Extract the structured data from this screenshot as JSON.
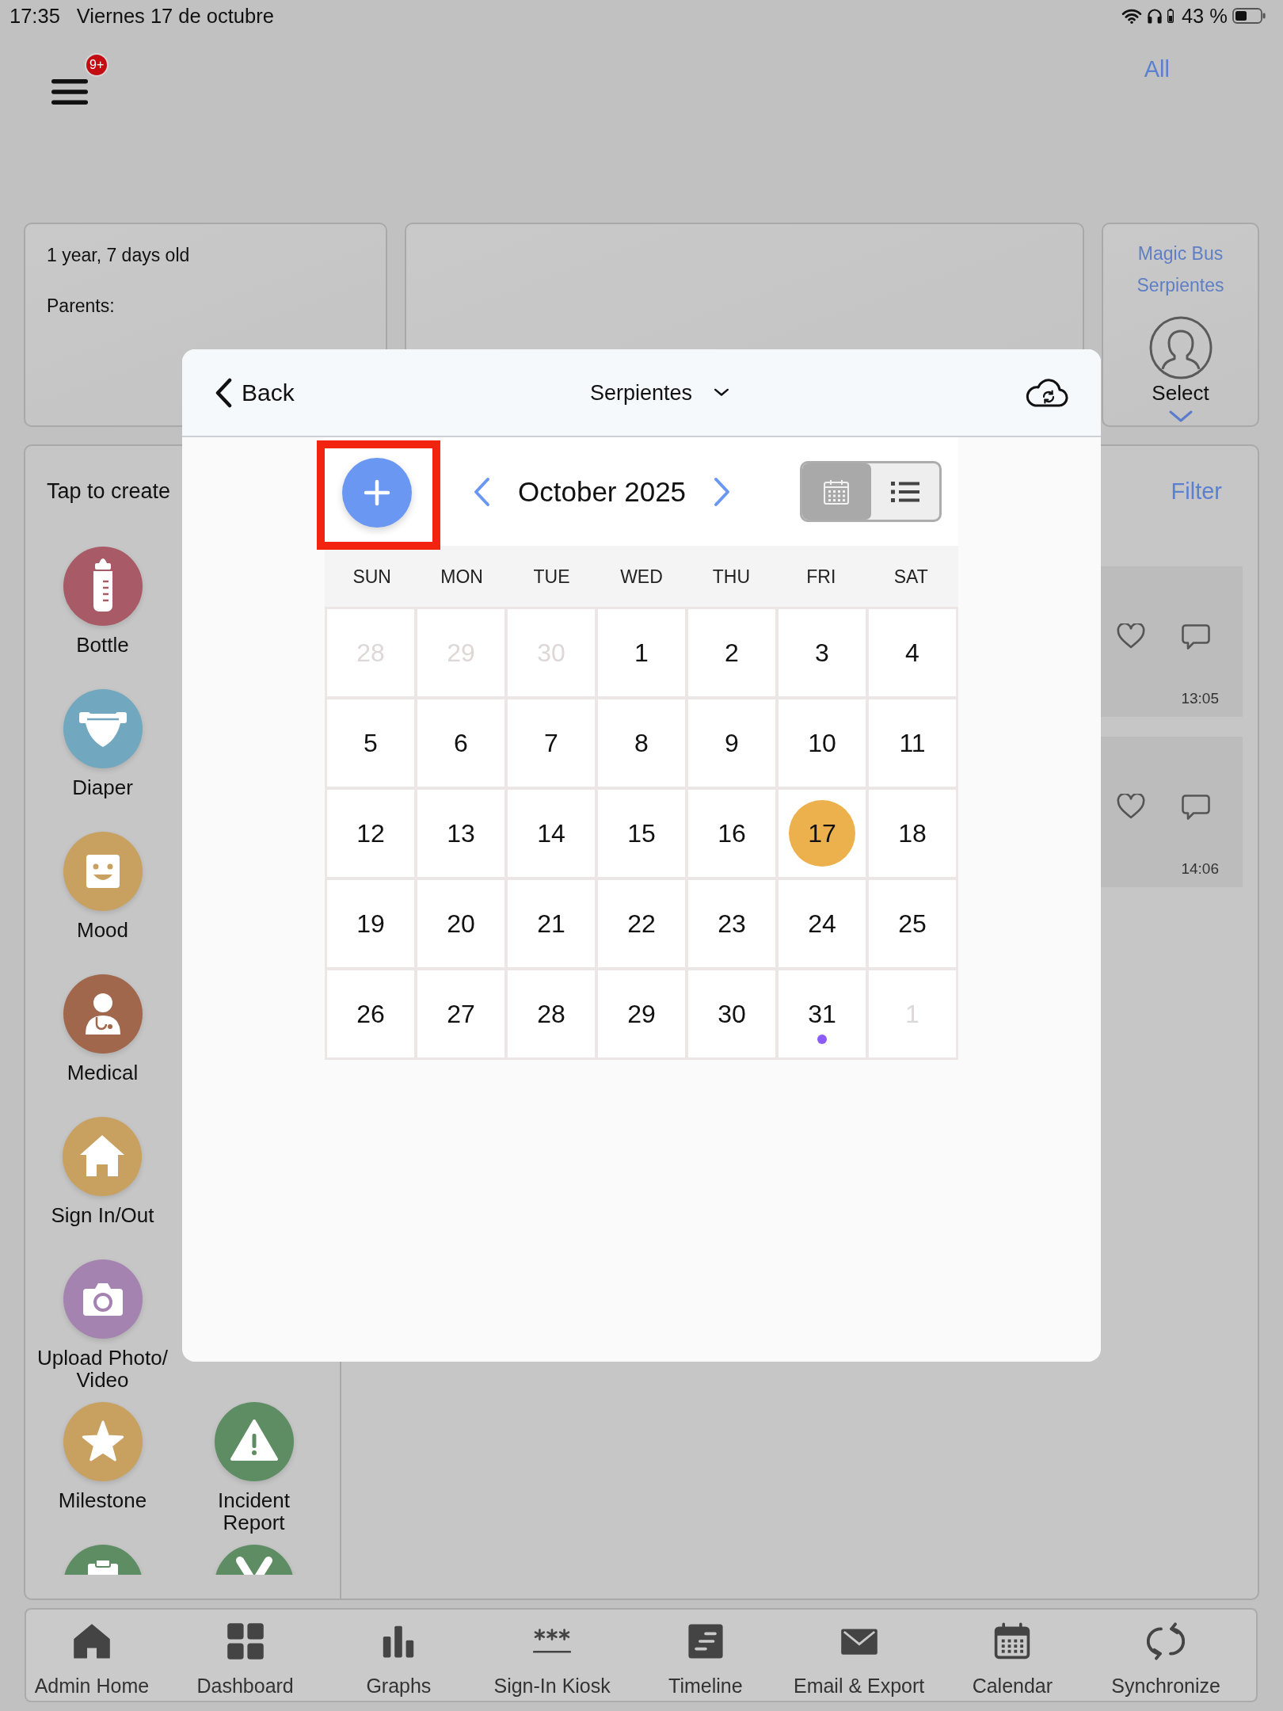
{
  "status_bar": {
    "time": "17:35",
    "date": "Viernes 17 de octubre",
    "battery": "43 %"
  },
  "header": {
    "badge": "9+",
    "all_link": "All"
  },
  "child_card": {
    "age": "1 year, 7 days old",
    "parents": "Parents:"
  },
  "group_card": {
    "bus": "Magic Bus",
    "room": "Serpientes",
    "select": "Select"
  },
  "create_panel": {
    "title": "Tap to create",
    "actions": [
      {
        "kind": "bottle",
        "label": "Bottle",
        "color": "#a85b66"
      },
      {
        "kind": "diaper",
        "label": "Diaper",
        "color": "#72a8bf"
      },
      {
        "kind": "mood",
        "label": "Mood",
        "color": "#c8a160"
      },
      {
        "kind": "medical",
        "label": "Medical",
        "color": "#a0674c"
      },
      {
        "kind": "sign_in_out",
        "label": "Sign In/Out",
        "color": "#c8a160"
      },
      {
        "kind": "photo",
        "label": "Upload Photo/​Video",
        "color": "#a583b0"
      },
      {
        "kind": "milestone",
        "label": "Milestone",
        "color": "#c8a160"
      },
      {
        "kind": "incident",
        "label": "Incident Report",
        "color": "#5e8d64"
      },
      {
        "kind": "clipboard",
        "color": "#5e8d64"
      },
      {
        "kind": "cross",
        "color": "#5e8d64"
      }
    ]
  },
  "timeline": {
    "filter": "Filter",
    "entries": [
      {
        "time": "13:05"
      },
      {
        "time": "14:06"
      }
    ]
  },
  "modal": {
    "back": "Back",
    "group": "Serpientes",
    "add_button_highlighted": true,
    "month": "October 2025",
    "view_modes": [
      {
        "kind": "calendar",
        "selected": true
      },
      {
        "kind": "list",
        "selected": false
      }
    ],
    "weekdays": [
      "SUN",
      "MON",
      "TUE",
      "WED",
      "THU",
      "FRI",
      "SAT"
    ],
    "days": [
      {
        "day": "28",
        "in_month": false,
        "today": false,
        "event": false
      },
      {
        "day": "29",
        "in_month": false,
        "today": false,
        "event": false
      },
      {
        "day": "30",
        "in_month": false,
        "today": false,
        "event": false
      },
      {
        "day": "1",
        "in_month": true,
        "today": false,
        "event": false
      },
      {
        "day": "2",
        "in_month": true,
        "today": false,
        "event": false
      },
      {
        "day": "3",
        "in_month": true,
        "today": false,
        "event": false
      },
      {
        "day": "4",
        "in_month": true,
        "today": false,
        "event": false
      },
      {
        "day": "5",
        "in_month": true,
        "today": false,
        "event": false
      },
      {
        "day": "6",
        "in_month": true,
        "today": false,
        "event": false
      },
      {
        "day": "7",
        "in_month": true,
        "today": false,
        "event": false
      },
      {
        "day": "8",
        "in_month": true,
        "today": false,
        "event": false
      },
      {
        "day": "9",
        "in_month": true,
        "today": false,
        "event": false
      },
      {
        "day": "10",
        "in_month": true,
        "today": false,
        "event": false
      },
      {
        "day": "11",
        "in_month": true,
        "today": false,
        "event": false
      },
      {
        "day": "12",
        "in_month": true,
        "today": false,
        "event": false
      },
      {
        "day": "13",
        "in_month": true,
        "today": false,
        "event": false
      },
      {
        "day": "14",
        "in_month": true,
        "today": false,
        "event": false
      },
      {
        "day": "15",
        "in_month": true,
        "today": false,
        "event": false
      },
      {
        "day": "16",
        "in_month": true,
        "today": false,
        "event": false
      },
      {
        "day": "17",
        "in_month": true,
        "today": true,
        "event": false
      },
      {
        "day": "18",
        "in_month": true,
        "today": false,
        "event": false
      },
      {
        "day": "19",
        "in_month": true,
        "today": false,
        "event": false
      },
      {
        "day": "20",
        "in_month": true,
        "today": false,
        "event": false
      },
      {
        "day": "21",
        "in_month": true,
        "today": false,
        "event": false
      },
      {
        "day": "22",
        "in_month": true,
        "today": false,
        "event": false
      },
      {
        "day": "23",
        "in_month": true,
        "today": false,
        "event": false
      },
      {
        "day": "24",
        "in_month": true,
        "today": false,
        "event": false
      },
      {
        "day": "25",
        "in_month": true,
        "today": false,
        "event": false
      },
      {
        "day": "26",
        "in_month": true,
        "today": false,
        "event": false
      },
      {
        "day": "27",
        "in_month": true,
        "today": false,
        "event": false
      },
      {
        "day": "28",
        "in_month": true,
        "today": false,
        "event": false
      },
      {
        "day": "29",
        "in_month": true,
        "today": false,
        "event": false
      },
      {
        "day": "30",
        "in_month": true,
        "today": false,
        "event": false
      },
      {
        "day": "31",
        "in_month": true,
        "today": false,
        "event": true
      },
      {
        "day": "1",
        "in_month": false,
        "today": false,
        "event": false
      }
    ]
  },
  "tab_bar": [
    {
      "kind": "home",
      "label": "Admin Home"
    },
    {
      "kind": "dashboard",
      "label": "Dashboard"
    },
    {
      "kind": "graphs",
      "label": "Graphs"
    },
    {
      "kind": "kiosk",
      "label": "Sign-In Kiosk"
    },
    {
      "kind": "timeline",
      "label": "Timeline"
    },
    {
      "kind": "email",
      "label": "Email & Export"
    },
    {
      "kind": "calendar",
      "label": "Calendar"
    },
    {
      "kind": "sync",
      "label": "Synchronize"
    }
  ]
}
